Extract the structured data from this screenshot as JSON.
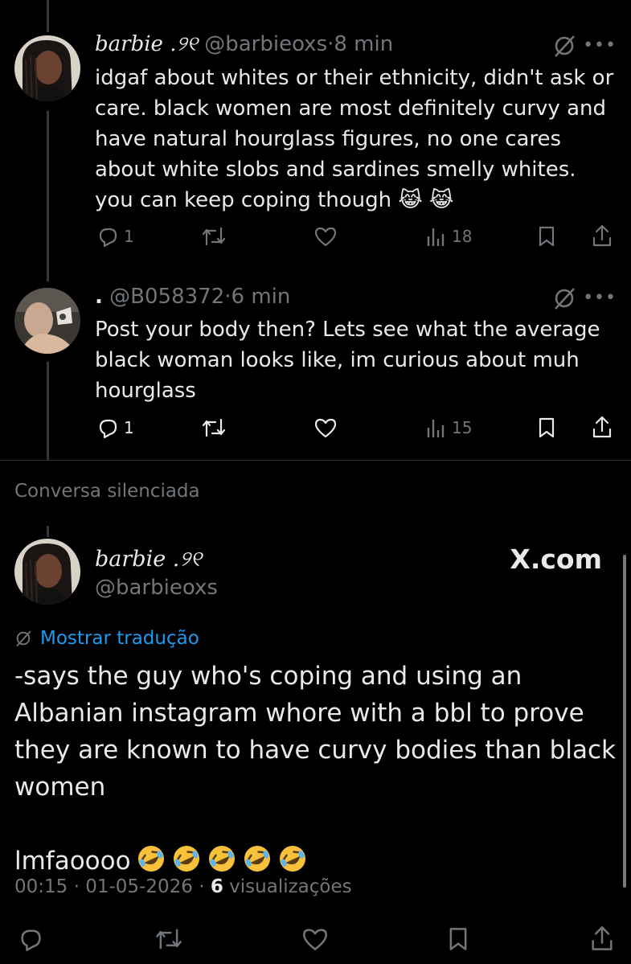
{
  "tweets": [
    {
      "name": "barbie",
      "name_symbol": ".୨୧",
      "handle": "@barbieoxs",
      "sep": "·",
      "time": "8 min",
      "text": "idgaf about whites or their ethnicity, didn't ask or care. black women are most definitely curvy and have natural hourglass figures, no one cares about white slobs and sardines smelly whites. you can keep coping though",
      "emojis": "😹 😹",
      "replies": "1",
      "views": "18"
    },
    {
      "name": ".",
      "handle": "@B058372",
      "sep": "·",
      "time": "6 min",
      "text": "Post your body then? Lets see what the average black woman looks like, im curious about muh hourglass",
      "replies": "1",
      "views": "15"
    }
  ],
  "silenced_label": "Conversa silenciada",
  "main": {
    "name": "barbie",
    "name_symbol": ".୨୧",
    "handle": "@barbieoxs",
    "source_badge": "X.com",
    "translate_label": "Mostrar tradução",
    "text": "-says the guy who's coping and using an Albanian instagram whore with a bbl to prove they are known to have curvy bodies than black women\n\nlmfaoooo",
    "emoji_count": 5,
    "time": "00:15",
    "date": "01-05-2026",
    "sep": "·",
    "views_count": "6",
    "views_label": "visualizações"
  },
  "icons": {
    "reply": "reply-icon",
    "retweet": "retweet-icon",
    "like": "like-icon",
    "views": "views-icon",
    "bookmark": "bookmark-icon",
    "share": "share-icon",
    "grok": "grok-icon",
    "more": "more-icon"
  },
  "colors": {
    "background": "#000000",
    "text": "#e7e9ea",
    "muted": "#71767b",
    "link": "#1d9bf0",
    "thread_line": "#333639"
  }
}
